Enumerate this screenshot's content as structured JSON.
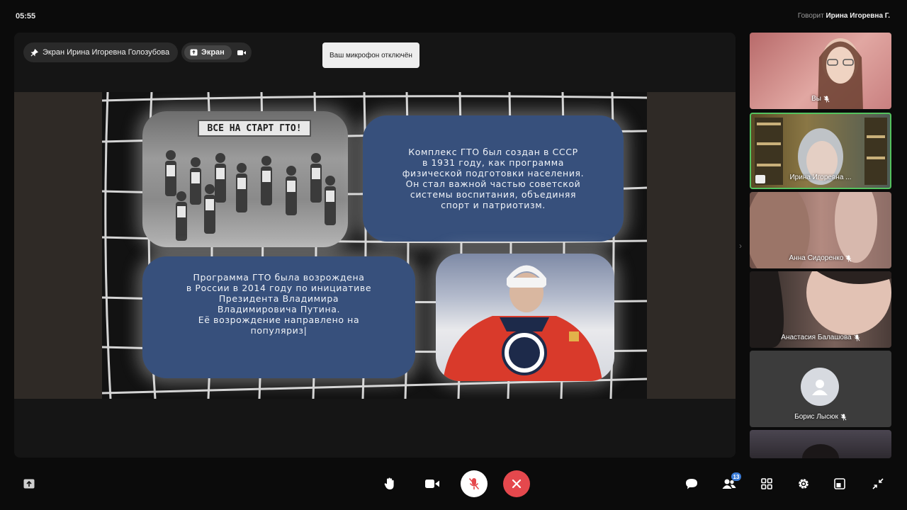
{
  "header": {
    "time": "05:55",
    "speaking_prefix": "Говорит",
    "speaking_name": "Ирина Игоревна Г."
  },
  "stage": {
    "presenter_label": "Экран Ирина Игоревна Голозубова",
    "screen_chip_label": "Экран",
    "toast": "Ваш микрофон отключён"
  },
  "slide": {
    "banner_text": "ВСЕ НА СТАРТ ГТО!",
    "card1_text": "Комплекс ГТО был создан в СССР\nв 1931 году, как программа\nфизической подготовки населения.\nОн стал важной частью советской\nсистемы воспитания, объединяя\nспорт и патриотизм.",
    "card2_text": "Программа ГТО была возрождена\nв России в 2014 году по инициативе\nПрезидента Владимира\nВладимировича Путина.\nЕё возрождение направлено на\nпопуляриз|"
  },
  "participants": [
    {
      "name": "Вы",
      "muted": true,
      "active": false,
      "kind": "video",
      "tone": "#c98080"
    },
    {
      "name": "Ирина Игоревна ...",
      "muted": false,
      "active": true,
      "kind": "video",
      "tone": "#7a6a3a"
    },
    {
      "name": "Анна Сидоренко",
      "muted": true,
      "active": false,
      "kind": "video",
      "tone": "#8a6860"
    },
    {
      "name": "Анастасия Балашова",
      "muted": true,
      "active": false,
      "kind": "video",
      "tone": "#6a5a55"
    },
    {
      "name": "Борис Лысюк",
      "muted": true,
      "active": false,
      "kind": "avatar",
      "tone": "#3c3c3c"
    },
    {
      "name": "",
      "muted": false,
      "active": false,
      "kind": "video",
      "tone": "#4a4550"
    }
  ],
  "toolbar": {
    "participants_count": "13"
  },
  "colors": {
    "accent_green": "#54c25e",
    "hangup_red": "#e5484d",
    "card_blue": "#37507c",
    "badge_blue": "#3a7bd5"
  },
  "icons": [
    "pin-icon",
    "screen-share-icon",
    "camera-icon",
    "raise-hand-icon",
    "mic-off-icon",
    "hang-up-icon",
    "chat-icon",
    "participants-icon",
    "grid-icon",
    "settings-icon",
    "layout-icon",
    "collapse-icon"
  ]
}
